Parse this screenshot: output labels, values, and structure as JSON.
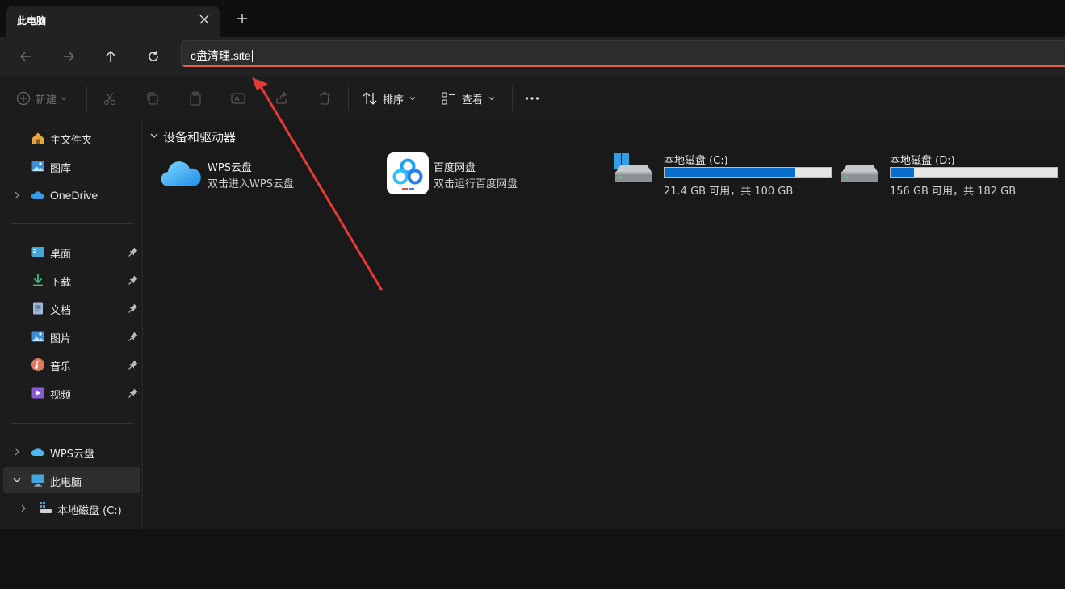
{
  "window": {
    "tab_title": "此电脑"
  },
  "address_bar": {
    "value": "c盘清理.site"
  },
  "toolbar": {
    "new_label": "新建",
    "sort_label": "排序",
    "view_label": "查看"
  },
  "sidebar": {
    "quick": [
      {
        "label": "主文件夹",
        "icon": "home-icon"
      },
      {
        "label": "图库",
        "icon": "gallery-icon"
      },
      {
        "label": "OneDrive",
        "icon": "onedrive-icon"
      }
    ],
    "pinned": [
      {
        "label": "桌面",
        "icon": "desktop-icon"
      },
      {
        "label": "下载",
        "icon": "download-icon"
      },
      {
        "label": "文档",
        "icon": "document-icon"
      },
      {
        "label": "图片",
        "icon": "pictures-icon"
      },
      {
        "label": "音乐",
        "icon": "music-icon"
      },
      {
        "label": "视频",
        "icon": "video-icon"
      }
    ],
    "devices": [
      {
        "label": "WPS云盘",
        "icon": "wps-cloud-icon"
      },
      {
        "label": "此电脑",
        "icon": "this-pc-icon"
      },
      {
        "label": "本地磁盘 (C:)",
        "icon": "drive-icon"
      }
    ]
  },
  "main": {
    "section_title": "设备和驱动器",
    "apps": [
      {
        "name": "WPS云盘",
        "subtitle": "双击进入WPS云盘"
      },
      {
        "name": "百度网盘",
        "subtitle": "双击运行百度网盘"
      }
    ],
    "drives": [
      {
        "name": "本地磁盘 (C:)",
        "free_text": "21.4 GB 可用，共 100 GB",
        "used_fraction": 0.786
      },
      {
        "name": "本地磁盘 (D:)",
        "free_text": "156 GB 可用，共 182 GB",
        "used_fraction": 0.143
      }
    ]
  },
  "colors": {
    "accent": "#0a6fcc",
    "address_underline": "#e5604b",
    "annotation_arrow": "#e53935"
  }
}
